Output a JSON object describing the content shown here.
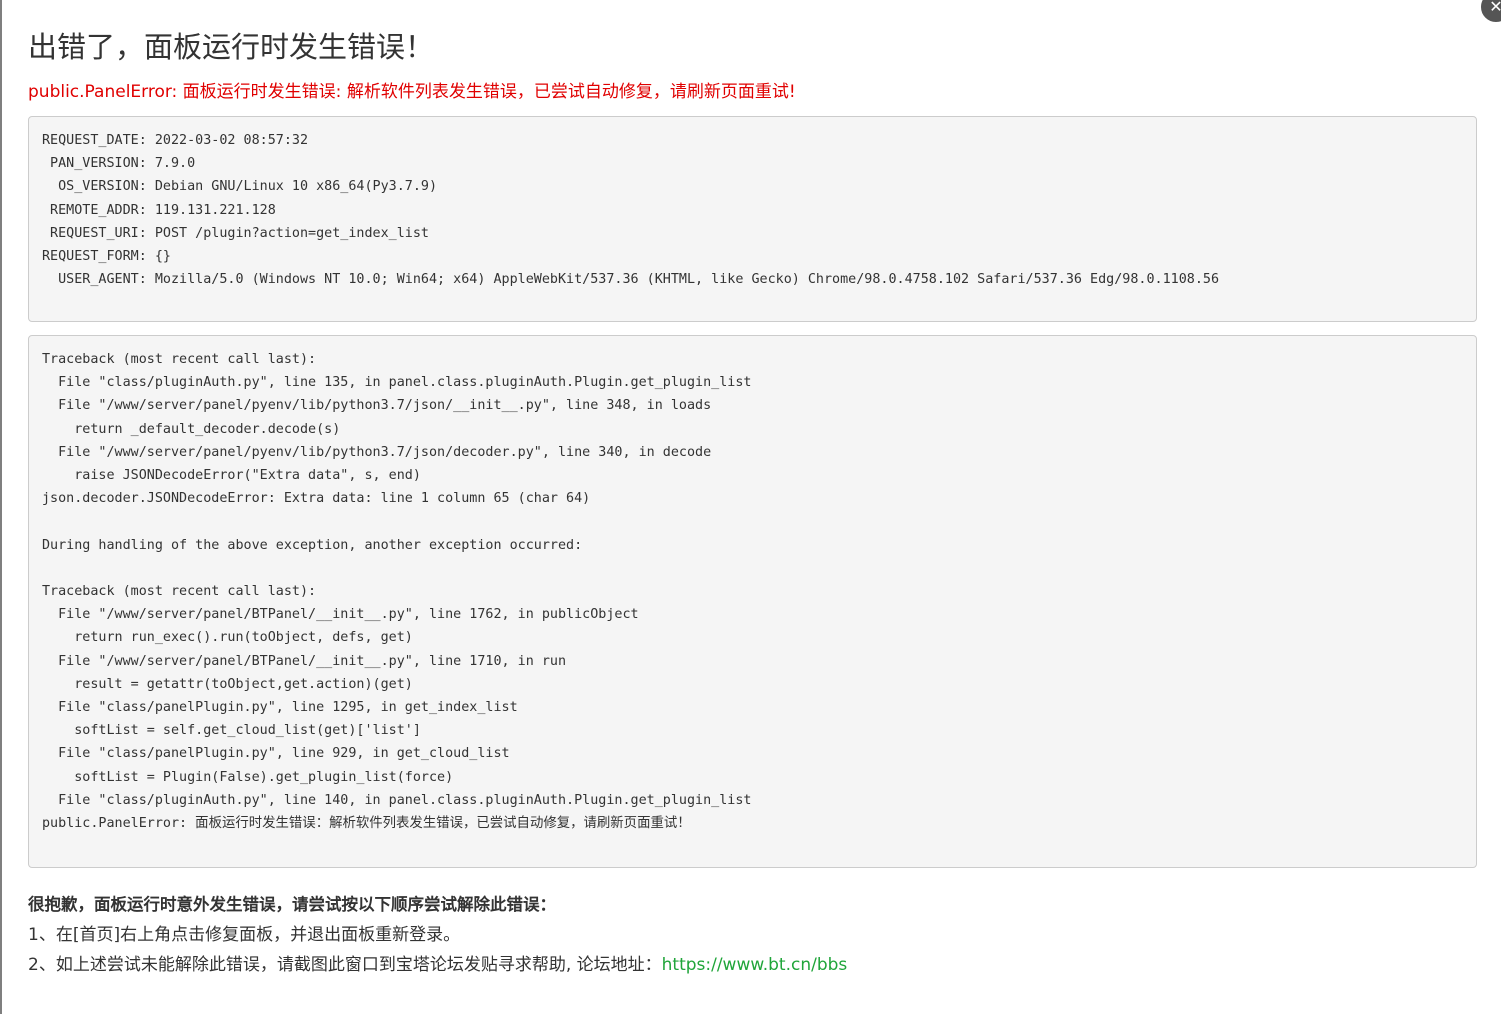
{
  "title": "出错了，面板运行时发生错误！",
  "error_message": "public.PanelError: 面板运行时发生错误: 解析软件列表发生错误，已尝试自动修复，请刷新页面重试!",
  "request_info": [
    "REQUEST_DATE: 2022-03-02 08:57:32",
    " PAN_VERSION: 7.9.0",
    "  OS_VERSION: Debian GNU/Linux 10 x86_64(Py3.7.9)",
    " REMOTE_ADDR: 119.131.221.128",
    " REQUEST_URI: POST /plugin?action=get_index_list",
    "REQUEST_FORM: {}",
    "  USER_AGENT: Mozilla/5.0 (Windows NT 10.0; Win64; x64) AppleWebKit/537.36 (KHTML, like Gecko) Chrome/98.0.4758.102 Safari/537.36 Edg/98.0.1108.56"
  ],
  "traceback": [
    "Traceback (most recent call last):",
    "  File \"class/pluginAuth.py\", line 135, in panel.class.pluginAuth.Plugin.get_plugin_list",
    "  File \"/www/server/panel/pyenv/lib/python3.7/json/__init__.py\", line 348, in loads",
    "    return _default_decoder.decode(s)",
    "  File \"/www/server/panel/pyenv/lib/python3.7/json/decoder.py\", line 340, in decode",
    "    raise JSONDecodeError(\"Extra data\", s, end)",
    "json.decoder.JSONDecodeError: Extra data: line 1 column 65 (char 64)",
    "",
    "During handling of the above exception, another exception occurred:",
    "",
    "Traceback (most recent call last):",
    "  File \"/www/server/panel/BTPanel/__init__.py\", line 1762, in publicObject",
    "    return run_exec().run(toObject, defs, get)",
    "  File \"/www/server/panel/BTPanel/__init__.py\", line 1710, in run",
    "    result = getattr(toObject,get.action)(get)",
    "  File \"class/panelPlugin.py\", line 1295, in get_index_list",
    "    softList = self.get_cloud_list(get)['list']",
    "  File \"class/panelPlugin.py\", line 929, in get_cloud_list",
    "    softList = Plugin(False).get_plugin_list(force)",
    "  File \"class/pluginAuth.py\", line 140, in panel.class.pluginAuth.Plugin.get_plugin_list",
    "public.PanelError: 面板运行时发生错误：解析软件列表发生错误，已尝试自动修复，请刷新页面重试！"
  ],
  "help": {
    "title": "很抱歉，面板运行时意外发生错误，请尝试按以下顺序尝试解除此错误：",
    "step1": "1、在[首页]右上角点击修复面板，并退出面板重新登录。",
    "step2_prefix": "2、如上述尝试未能解除此错误，请截图此窗口到宝塔论坛发贴寻求帮助, 论坛地址：",
    "forum_link": "https://www.bt.cn/bbs"
  },
  "icons": {
    "close": "close-icon"
  },
  "colors": {
    "error": "#e00000",
    "link": "#20a53a",
    "box_bg": "#f5f5f5"
  }
}
